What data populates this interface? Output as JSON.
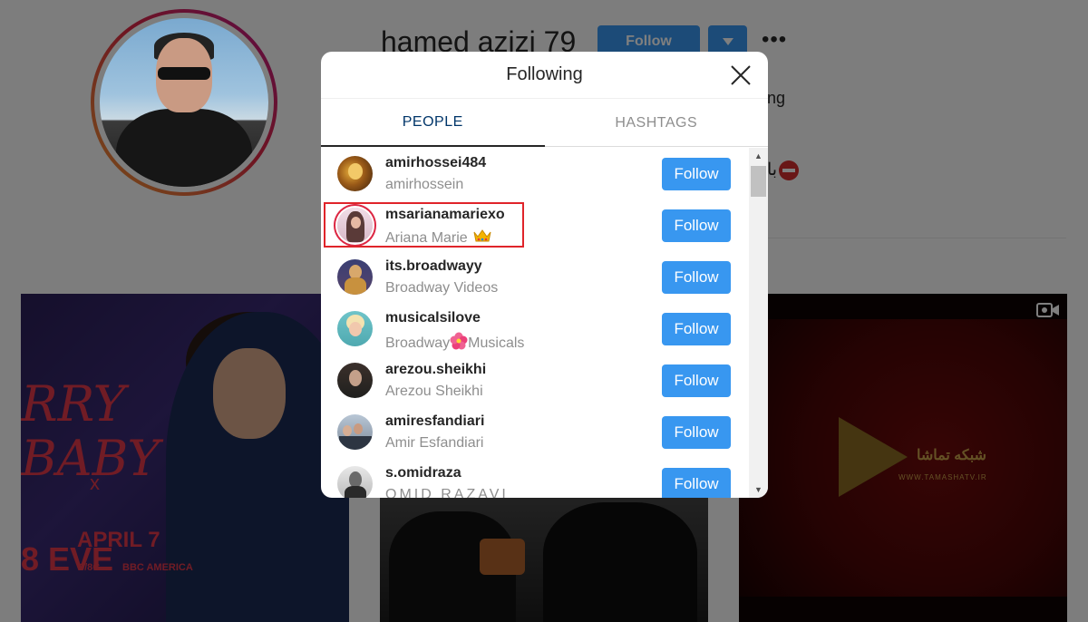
{
  "profile": {
    "username": "hamed azizi 79",
    "follow_label": "Follow",
    "stats_fragment": "ng",
    "bio_fragment": "با"
  },
  "modal": {
    "title": "Following",
    "tabs": [
      {
        "label": "PEOPLE",
        "active": true
      },
      {
        "label": "HASHTAGS",
        "active": false
      }
    ]
  },
  "following": [
    {
      "username": "amirhossei484",
      "full_name": "amirhossein",
      "button": "Follow"
    },
    {
      "username": "msarianamariexo",
      "full_name": "Ariana Marie",
      "emoji": "crown-emoji-icon",
      "button": "Follow",
      "highlighted": true
    },
    {
      "username": "its.broadwayy",
      "full_name": "Broadway Videos",
      "button": "Follow"
    },
    {
      "username": "musicalsilove",
      "full_name_parts": [
        "Broadway",
        "Musicals"
      ],
      "emoji": "hibiscus-emoji-icon",
      "button": "Follow"
    },
    {
      "username": "arezou.sheikhi",
      "full_name": "Arezou Sheikhi",
      "button": "Follow"
    },
    {
      "username": "amiresfandiari",
      "full_name": "Amir Esfandiari",
      "button": "Follow"
    },
    {
      "username": "s.omidraza",
      "full_name": "OMID RAZAVI",
      "button": "Follow"
    }
  ],
  "posts": {
    "post1": {
      "line1": "RRY",
      "line2": "BABY",
      "line3": "8 EVE",
      "date": "APRIL 7",
      "x": "x",
      "channel": "9/8C",
      "network": "BBC AMERICA"
    },
    "post3": {
      "brand": "شبکه تماشا",
      "url": "WWW.TAMASHATV.IR"
    }
  },
  "colors": {
    "primary_blue": "#3897f0",
    "tab_active": "#003569",
    "highlight_red": "#e0242a"
  }
}
